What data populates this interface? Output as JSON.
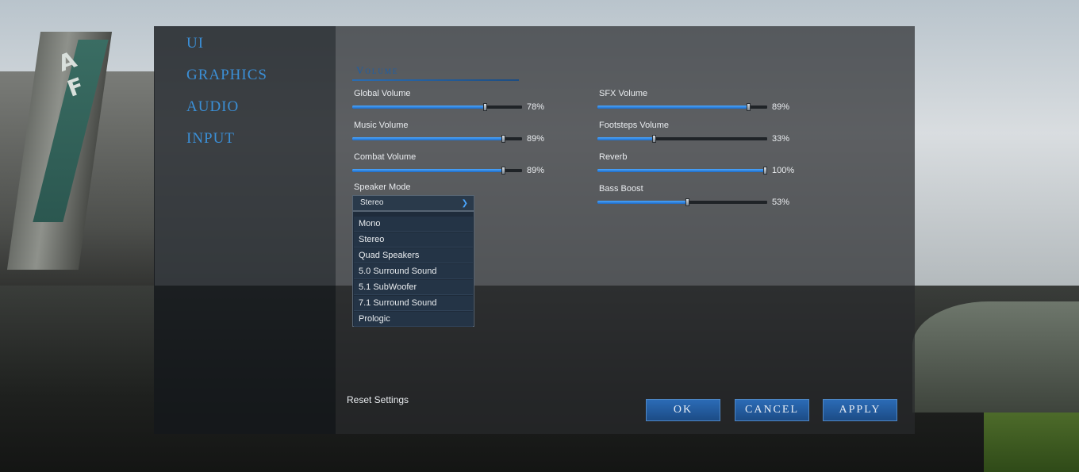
{
  "nav": [
    {
      "label": "UI"
    },
    {
      "label": "GRAPHICS"
    },
    {
      "label": "AUDIO"
    },
    {
      "label": "INPUT"
    }
  ],
  "section": {
    "title": "Volume"
  },
  "sliders_left": [
    {
      "label": "Global Volume",
      "value": 78,
      "display": "78%"
    },
    {
      "label": "Music Volume",
      "value": 89,
      "display": "89%"
    },
    {
      "label": "Combat Volume",
      "value": 89,
      "display": "89%"
    }
  ],
  "sliders_right": [
    {
      "label": "SFX Volume",
      "value": 89,
      "display": "89%"
    },
    {
      "label": "Footsteps Volume",
      "value": 33,
      "display": "33%"
    },
    {
      "label": "Reverb",
      "value": 100,
      "display": "100%"
    },
    {
      "label": "Bass Boost",
      "value": 53,
      "display": "53%"
    }
  ],
  "speaker_mode": {
    "label": "Speaker Mode",
    "selected": "Stereo",
    "options": [
      "Mono",
      "Stereo",
      "Quad Speakers",
      "5.0 Surround Sound",
      "5.1 SubWoofer",
      "7.1 Surround Sound",
      "Prologic"
    ]
  },
  "reset_label": "Reset Settings",
  "buttons": {
    "ok": "OK",
    "cancel": "CANCEL",
    "apply": "APPLY"
  },
  "colors": {
    "accent": "#3b8fd6",
    "button": "#2b6bb6",
    "slider_fill": "#4aa6ff"
  }
}
